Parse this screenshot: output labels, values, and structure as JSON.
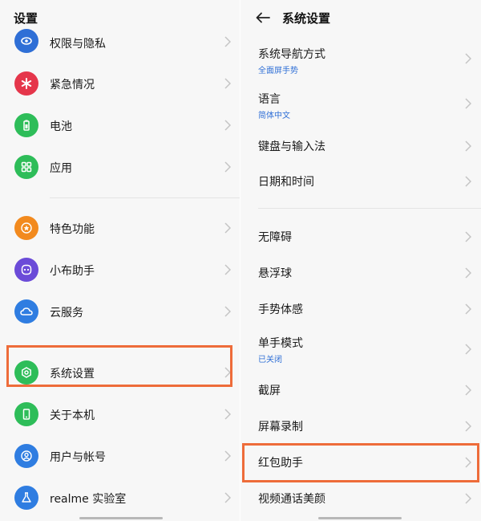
{
  "left": {
    "title": "设置",
    "items": [
      {
        "label": "权限与隐私",
        "icon": "privacy-eye-icon",
        "color": "#2f6fd6"
      },
      {
        "label": "紧急情况",
        "icon": "emergency-asterisk-icon",
        "color": "#e5364b"
      },
      {
        "label": "电池",
        "icon": "battery-icon",
        "color": "#2ebd59"
      },
      {
        "label": "应用",
        "icon": "apps-grid-icon",
        "color": "#2ebd59"
      },
      {
        "label": "特色功能",
        "icon": "star-icon",
        "color": "#f28a1e"
      },
      {
        "label": "小布助手",
        "icon": "assistant-icon",
        "color": "#6b4bd8"
      },
      {
        "label": "云服务",
        "icon": "cloud-icon",
        "color": "#2f7de1"
      },
      {
        "label": "系统设置",
        "icon": "system-settings-icon",
        "color": "#2ebd59"
      },
      {
        "label": "关于本机",
        "icon": "phone-icon",
        "color": "#2ebd59"
      },
      {
        "label": "用户与帐号",
        "icon": "user-icon",
        "color": "#2f7de1"
      },
      {
        "label": "realme 实验室",
        "icon": "lab-flask-icon",
        "color": "#2f7de1"
      }
    ]
  },
  "right": {
    "title": "系统设置",
    "items": [
      {
        "label": "系统导航方式",
        "sub": "全面屏手势"
      },
      {
        "label": "语言",
        "sub": "简体中文"
      },
      {
        "label": "键盘与输入法",
        "sub": ""
      },
      {
        "label": "日期和时间",
        "sub": ""
      },
      {
        "label": "无障碍",
        "sub": ""
      },
      {
        "label": "悬浮球",
        "sub": ""
      },
      {
        "label": "手势体感",
        "sub": ""
      },
      {
        "label": "单手模式",
        "sub": "已关闭"
      },
      {
        "label": "截屏",
        "sub": ""
      },
      {
        "label": "屏幕录制",
        "sub": ""
      },
      {
        "label": "红包助手",
        "sub": ""
      },
      {
        "label": "视频通话美颜",
        "sub": ""
      }
    ]
  },
  "colors": {
    "highlight": "#ee6c3a",
    "subtitle_blue": "#2f6fd6"
  }
}
